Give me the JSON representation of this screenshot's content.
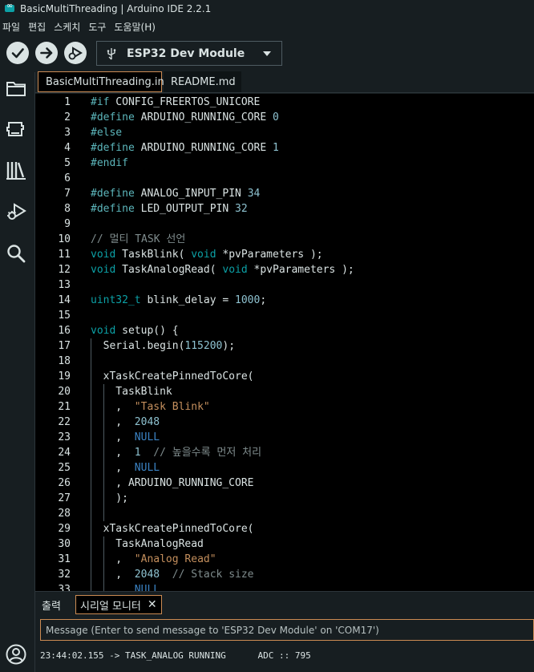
{
  "window": {
    "title": "BasicMultiThreading | Arduino IDE 2.2.1"
  },
  "menu": [
    "파일",
    "편집",
    "스케치",
    "도구",
    "도움말(H)"
  ],
  "toolbar": {
    "verify_icon": "check-icon",
    "upload_icon": "arrow-right-icon",
    "debug_icon": "debug-icon",
    "board": "ESP32 Dev Module"
  },
  "sidebar": [
    "folder-icon",
    "board-manager-icon",
    "library-icon",
    "debug-icon",
    "search-icon",
    "account-icon"
  ],
  "tabs": [
    {
      "label": "BasicMultiThreading.ino",
      "active": true
    },
    {
      "label": "README.md",
      "active": false
    }
  ],
  "code": [
    "#if CONFIG_FREERTOS_UNICORE",
    "#define ARDUINO_RUNNING_CORE 0",
    "#else",
    "#define ARDUINO_RUNNING_CORE 1",
    "#endif",
    "",
    "#define ANALOG_INPUT_PIN 34",
    "#define LED_OUTPUT_PIN 32",
    "",
    "// 멀티 TASK 선언",
    "void TaskBlink( void *pvParameters );",
    "void TaskAnalogRead( void *pvParameters );",
    "",
    "uint32_t blink_delay = 1000;",
    "",
    "void setup() {",
    "  Serial.begin(115200);",
    "",
    "  xTaskCreatePinnedToCore(",
    "    TaskBlink",
    "    ,  \"Task Blink\"",
    "    ,  2048",
    "    ,  NULL",
    "    ,  1  // 높을수록 먼저 처리",
    "    ,  NULL",
    "    , ARDUINO_RUNNING_CORE",
    "    );",
    "",
    "  xTaskCreatePinnedToCore(",
    "    TaskAnalogRead",
    "    ,  \"Analog Read\"",
    "    ,  2048  // Stack size",
    "    ,  NULL"
  ],
  "panel": {
    "output_tab": "출력",
    "serial_tab": "시리얼 모니터",
    "close_label": "✕",
    "message_placeholder": "Message (Enter to send message to 'ESP32 Dev Module' on 'COM17')",
    "serial_line": "23:44:02.155 -> TASK_ANALOG RUNNING      ADC :: 795"
  }
}
